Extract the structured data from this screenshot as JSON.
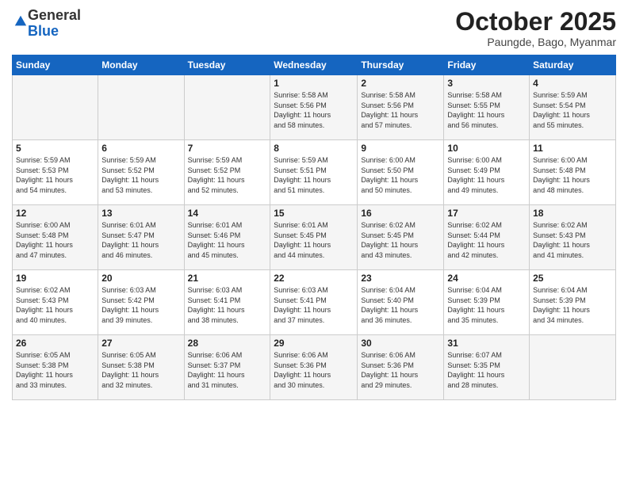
{
  "logo": {
    "general": "General",
    "blue": "Blue"
  },
  "header": {
    "month": "October 2025",
    "location": "Paungde, Bago, Myanmar"
  },
  "weekdays": [
    "Sunday",
    "Monday",
    "Tuesday",
    "Wednesday",
    "Thursday",
    "Friday",
    "Saturday"
  ],
  "weeks": [
    [
      {
        "day": "",
        "info": ""
      },
      {
        "day": "",
        "info": ""
      },
      {
        "day": "",
        "info": ""
      },
      {
        "day": "1",
        "info": "Sunrise: 5:58 AM\nSunset: 5:56 PM\nDaylight: 11 hours\nand 58 minutes."
      },
      {
        "day": "2",
        "info": "Sunrise: 5:58 AM\nSunset: 5:56 PM\nDaylight: 11 hours\nand 57 minutes."
      },
      {
        "day": "3",
        "info": "Sunrise: 5:58 AM\nSunset: 5:55 PM\nDaylight: 11 hours\nand 56 minutes."
      },
      {
        "day": "4",
        "info": "Sunrise: 5:59 AM\nSunset: 5:54 PM\nDaylight: 11 hours\nand 55 minutes."
      }
    ],
    [
      {
        "day": "5",
        "info": "Sunrise: 5:59 AM\nSunset: 5:53 PM\nDaylight: 11 hours\nand 54 minutes."
      },
      {
        "day": "6",
        "info": "Sunrise: 5:59 AM\nSunset: 5:52 PM\nDaylight: 11 hours\nand 53 minutes."
      },
      {
        "day": "7",
        "info": "Sunrise: 5:59 AM\nSunset: 5:52 PM\nDaylight: 11 hours\nand 52 minutes."
      },
      {
        "day": "8",
        "info": "Sunrise: 5:59 AM\nSunset: 5:51 PM\nDaylight: 11 hours\nand 51 minutes."
      },
      {
        "day": "9",
        "info": "Sunrise: 6:00 AM\nSunset: 5:50 PM\nDaylight: 11 hours\nand 50 minutes."
      },
      {
        "day": "10",
        "info": "Sunrise: 6:00 AM\nSunset: 5:49 PM\nDaylight: 11 hours\nand 49 minutes."
      },
      {
        "day": "11",
        "info": "Sunrise: 6:00 AM\nSunset: 5:48 PM\nDaylight: 11 hours\nand 48 minutes."
      }
    ],
    [
      {
        "day": "12",
        "info": "Sunrise: 6:00 AM\nSunset: 5:48 PM\nDaylight: 11 hours\nand 47 minutes."
      },
      {
        "day": "13",
        "info": "Sunrise: 6:01 AM\nSunset: 5:47 PM\nDaylight: 11 hours\nand 46 minutes."
      },
      {
        "day": "14",
        "info": "Sunrise: 6:01 AM\nSunset: 5:46 PM\nDaylight: 11 hours\nand 45 minutes."
      },
      {
        "day": "15",
        "info": "Sunrise: 6:01 AM\nSunset: 5:45 PM\nDaylight: 11 hours\nand 44 minutes."
      },
      {
        "day": "16",
        "info": "Sunrise: 6:02 AM\nSunset: 5:45 PM\nDaylight: 11 hours\nand 43 minutes."
      },
      {
        "day": "17",
        "info": "Sunrise: 6:02 AM\nSunset: 5:44 PM\nDaylight: 11 hours\nand 42 minutes."
      },
      {
        "day": "18",
        "info": "Sunrise: 6:02 AM\nSunset: 5:43 PM\nDaylight: 11 hours\nand 41 minutes."
      }
    ],
    [
      {
        "day": "19",
        "info": "Sunrise: 6:02 AM\nSunset: 5:43 PM\nDaylight: 11 hours\nand 40 minutes."
      },
      {
        "day": "20",
        "info": "Sunrise: 6:03 AM\nSunset: 5:42 PM\nDaylight: 11 hours\nand 39 minutes."
      },
      {
        "day": "21",
        "info": "Sunrise: 6:03 AM\nSunset: 5:41 PM\nDaylight: 11 hours\nand 38 minutes."
      },
      {
        "day": "22",
        "info": "Sunrise: 6:03 AM\nSunset: 5:41 PM\nDaylight: 11 hours\nand 37 minutes."
      },
      {
        "day": "23",
        "info": "Sunrise: 6:04 AM\nSunset: 5:40 PM\nDaylight: 11 hours\nand 36 minutes."
      },
      {
        "day": "24",
        "info": "Sunrise: 6:04 AM\nSunset: 5:39 PM\nDaylight: 11 hours\nand 35 minutes."
      },
      {
        "day": "25",
        "info": "Sunrise: 6:04 AM\nSunset: 5:39 PM\nDaylight: 11 hours\nand 34 minutes."
      }
    ],
    [
      {
        "day": "26",
        "info": "Sunrise: 6:05 AM\nSunset: 5:38 PM\nDaylight: 11 hours\nand 33 minutes."
      },
      {
        "day": "27",
        "info": "Sunrise: 6:05 AM\nSunset: 5:38 PM\nDaylight: 11 hours\nand 32 minutes."
      },
      {
        "day": "28",
        "info": "Sunrise: 6:06 AM\nSunset: 5:37 PM\nDaylight: 11 hours\nand 31 minutes."
      },
      {
        "day": "29",
        "info": "Sunrise: 6:06 AM\nSunset: 5:36 PM\nDaylight: 11 hours\nand 30 minutes."
      },
      {
        "day": "30",
        "info": "Sunrise: 6:06 AM\nSunset: 5:36 PM\nDaylight: 11 hours\nand 29 minutes."
      },
      {
        "day": "31",
        "info": "Sunrise: 6:07 AM\nSunset: 5:35 PM\nDaylight: 11 hours\nand 28 minutes."
      },
      {
        "day": "",
        "info": ""
      }
    ]
  ]
}
